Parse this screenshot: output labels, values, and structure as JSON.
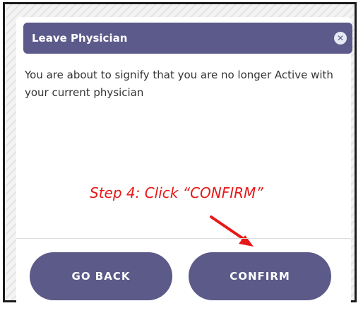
{
  "dialog": {
    "title": "Leave Physician",
    "close_icon": "close-circle-icon",
    "message": "You are about to signify that you are no longer Active with your current physician"
  },
  "annotation": {
    "text": "Step 4: Click “CONFIRM”",
    "color": "#e81818"
  },
  "buttons": {
    "go_back_label": "GO BACK",
    "confirm_label": "CONFIRM",
    "color": "#5b5a88"
  },
  "colors": {
    "titlebar": "#5c5a8a"
  }
}
